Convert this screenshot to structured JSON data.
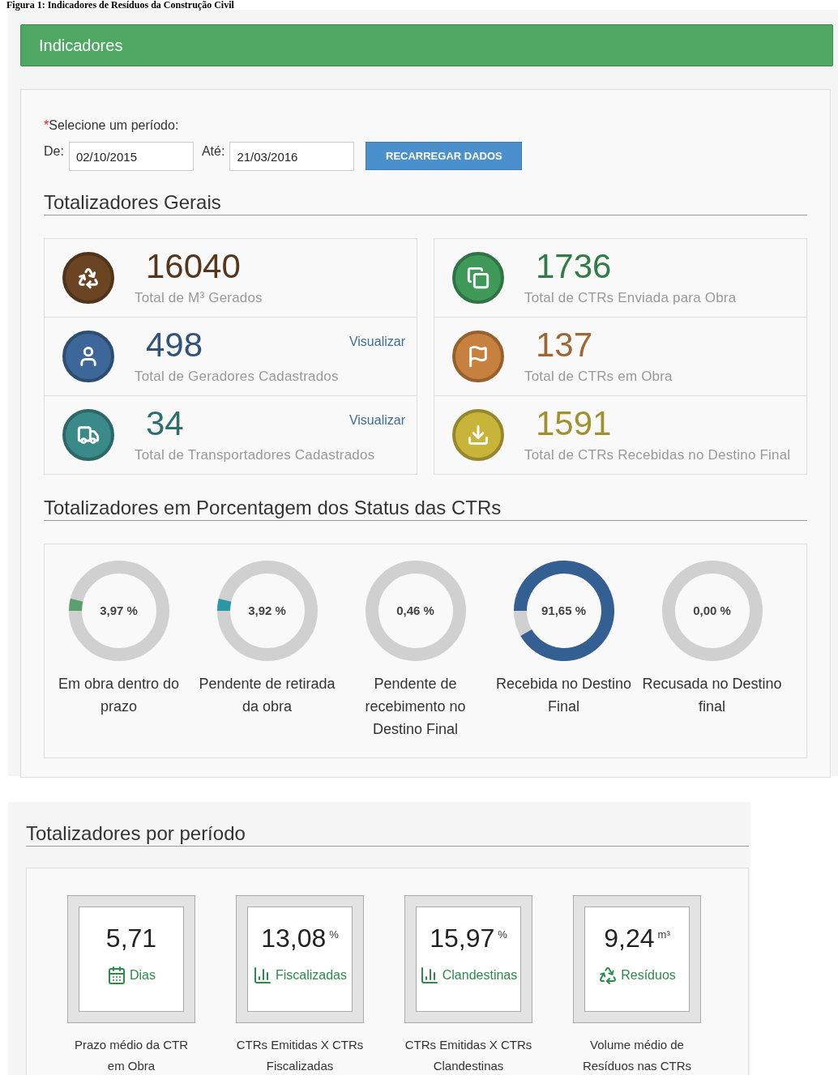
{
  "caption": "Figura 1: Indicadores de Resíduos da Construção Civil",
  "header": {
    "title": "Indicadores"
  },
  "period": {
    "label": "Selecione um período:",
    "required_mark": "*",
    "from_label": "De:",
    "from_value": "02/10/2015",
    "to_label": "Até:",
    "to_value": "21/03/2016",
    "button": "RECARREGAR DADOS"
  },
  "general": {
    "title": "Totalizadores Gerais",
    "stats": [
      {
        "value": "16040",
        "label": "Total de M³ Gerados",
        "color": "#6b4423"
      },
      {
        "value": "498",
        "label": "Total de Geradores Cadastrados",
        "link": "Visualizar",
        "color": "#3d6699"
      },
      {
        "value": "34",
        "label": "Total de Transportadores Cadastrados",
        "link": "Visualizar",
        "color": "#3a8a8a"
      },
      {
        "value": "1736",
        "label": "Total de CTRs Enviada para Obra",
        "color": "#3f9a5a"
      },
      {
        "value": "137",
        "label": "Total de CTRs em Obra",
        "color": "#c8803f"
      },
      {
        "value": "1591",
        "label": "Total de CTRs Recebidas no Destino Final",
        "color": "#c9b43a"
      }
    ]
  },
  "status": {
    "title": "Totalizadores em Porcentagem dos Status das CTRs",
    "donuts": [
      {
        "reading": "3,97 %",
        "label": "Em obra dentro do prazo"
      },
      {
        "reading": "3,92 %",
        "label": "Pendente de retirada da obra"
      },
      {
        "reading": "0,46 %",
        "label": "Pendente de recebimento no Destino Final"
      },
      {
        "reading": "91,65 %",
        "label": "Recebida no Destino Final"
      },
      {
        "reading": "0,00 %",
        "label": "Recusada no Destino final"
      }
    ]
  },
  "by_period": {
    "title": "Totalizadores por período",
    "cards": [
      {
        "value": "5,71",
        "tag": "Dias",
        "caption": "Prazo médio da CTR em Obra"
      },
      {
        "value": "13,08",
        "unit": "%",
        "tag": "Fiscalizadas",
        "caption": "CTRs Emitidas X CTRs Fiscalizadas"
      },
      {
        "value": "15,97",
        "unit": "%",
        "tag": "Clandestinas",
        "caption": "CTRs Emitidas X CTRs Clandestinas"
      },
      {
        "value": "9,24",
        "unit": "m³",
        "tag": "Resíduos",
        "caption": "Volume médio de Resíduos nas CTRs"
      }
    ]
  }
}
